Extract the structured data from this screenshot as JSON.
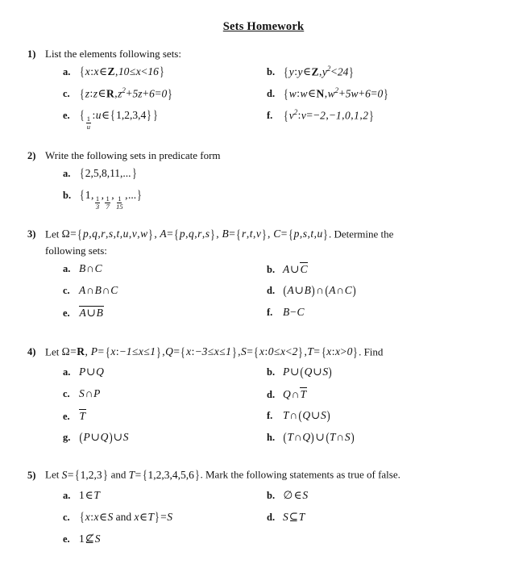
{
  "document": {
    "title": "Sets Homework"
  },
  "questions": [
    {
      "number": "1)",
      "prompt": "List the elements following sets:",
      "continuation": "",
      "columns": 2,
      "items": [
        {
          "label": "a.",
          "text": "{x : x ∈ Z, 10 ≤ x < 16}"
        },
        {
          "label": "b.",
          "text": "{y : y ∈ Z, y² < 24}"
        },
        {
          "label": "c.",
          "text": "{z : z ∈ R, z² + 5z + 6 = 0}"
        },
        {
          "label": "d.",
          "text": "{w : w ∈ N, w² + 5w + 6 = 0}"
        },
        {
          "label": "e.",
          "text": "{1/u : u ∈ {1,2,3,4}}"
        },
        {
          "label": "f.",
          "text": "{v² : v = −2, −1, 0, 1, 2}"
        }
      ]
    },
    {
      "number": "2)",
      "prompt": "Write the following sets in predicate form",
      "continuation": "",
      "columns": 1,
      "items": [
        {
          "label": "a.",
          "text": "{2,5,8,11,...}"
        },
        {
          "label": "b.",
          "text": "{1, 1/3, 1/7, 1/15, ...}"
        }
      ]
    },
    {
      "number": "3)",
      "prompt": "Let Ω = {p,q,r,s,t,u,v,w}, A = {p,q,r,s}, B = {r,t,v}, C = {p,s,t,u}. Determine the",
      "continuation": "following sets:",
      "columns": 2,
      "items": [
        {
          "label": "a.",
          "text": "B ∩ C"
        },
        {
          "label": "b.",
          "text": "A ∪ C̄"
        },
        {
          "label": "c.",
          "text": "A ∩ B ∩ C"
        },
        {
          "label": "d.",
          "text": "(A ∪ B) ∩ (A ∩ C)"
        },
        {
          "label": "e.",
          "text": "A ∪ B (complement)"
        },
        {
          "label": "f.",
          "text": "B − C"
        }
      ]
    },
    {
      "number": "4)",
      "prompt": "Let Ω = R, P = {x : −1 ≤ x ≤ 1}, Q = {x : −3 ≤ x ≤ 1}, S = {x : 0 ≤ x < 2}, T = {x : x > 0}. Find",
      "continuation": "",
      "columns": 2,
      "items": [
        {
          "label": "a.",
          "text": "P ∪ Q"
        },
        {
          "label": "b.",
          "text": "P ∪ (Q ∪ S)"
        },
        {
          "label": "c.",
          "text": "S ∩ P"
        },
        {
          "label": "d.",
          "text": "Q ∩ T̄"
        },
        {
          "label": "e.",
          "text": "T̄"
        },
        {
          "label": "f.",
          "text": "T ∩ (Q ∪ S)"
        },
        {
          "label": "g.",
          "text": "(P ∪ Q) ∪ S"
        },
        {
          "label": "h.",
          "text": "(T ∩ Q) ∪ (T ∩ S)"
        }
      ]
    },
    {
      "number": "5)",
      "prompt": "Let S = {1,2,3} and T = {1,2,3,4,5,6}. Mark the following statements as true of false.",
      "continuation": "",
      "columns": 2,
      "items": [
        {
          "label": "a.",
          "text": "1 ∈ T"
        },
        {
          "label": "b.",
          "text": "∅ ∈ S"
        },
        {
          "label": "c.",
          "text": "{x : x ∈ S and x ∈ T} = S"
        },
        {
          "label": "d.",
          "text": "S ⊆ T"
        },
        {
          "label": "e.",
          "text": "1 ⊈ S"
        }
      ]
    }
  ],
  "labels": {
    "q1_num": "1)",
    "q2_num": "2)",
    "q3_num": "3)",
    "q4_num": "4)",
    "q5_num": "5)",
    "q1_prompt": "List the elements following sets:",
    "q2_prompt": "Write the following sets in predicate form",
    "q3_cont": "following sets:",
    "q3_tail": ". Determine the",
    "q4_tail": ". Find",
    "q5_tail": ". Mark the following statements as true of false.",
    "q5_let": "Let ",
    "q5_and": " and ",
    "let": "Let ",
    "a": "a.",
    "b": "b.",
    "c": "c.",
    "d": "d.",
    "e": "e.",
    "f": "f.",
    "g": "g.",
    "h": "h."
  },
  "colors": {
    "page_background": "#ffffff",
    "text": "#111111"
  }
}
